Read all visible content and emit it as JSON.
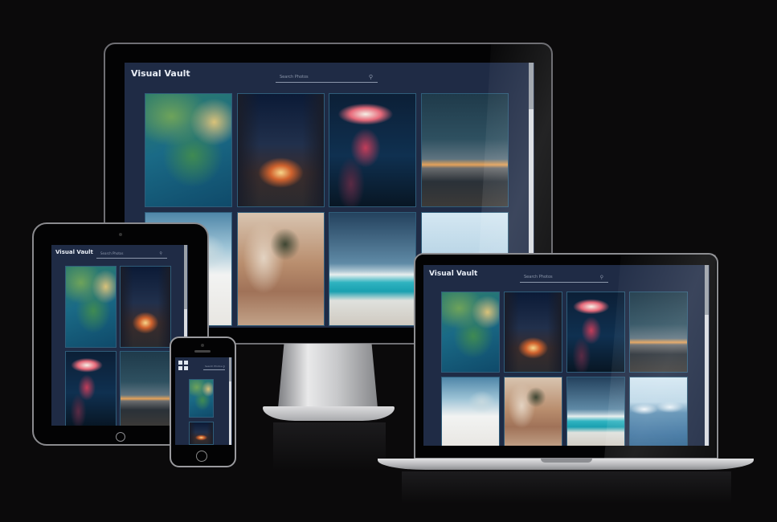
{
  "app": {
    "title": "Visual Vault",
    "search_placeholder": "Search Photos"
  },
  "icons": {
    "search": "search-icon",
    "menu": "menu-icon"
  },
  "colors": {
    "background": "#0b0a0b",
    "app_background": "#1f2b45",
    "logo_text": "#e8edf5",
    "search_text": "#8c97ab"
  }
}
